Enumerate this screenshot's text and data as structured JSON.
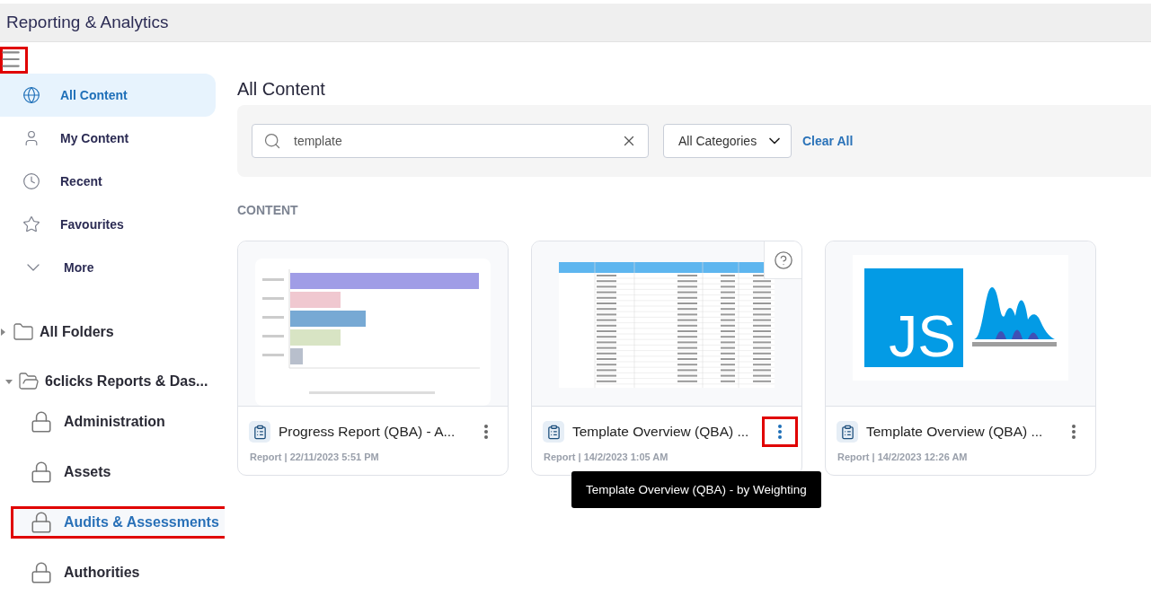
{
  "header": {
    "title": "Reporting & Analytics"
  },
  "menu_button": {
    "highlighted": true
  },
  "nav": [
    {
      "label": "All Content",
      "kind": "globe",
      "selected": true
    },
    {
      "label": "My Content",
      "kind": "user",
      "selected": false
    },
    {
      "label": "Recent",
      "kind": "clock",
      "selected": false
    },
    {
      "label": "Favourites",
      "kind": "star",
      "selected": false
    },
    {
      "label": "More",
      "kind": "chevron",
      "selected": false
    }
  ],
  "folders": [
    {
      "label": "All Folders",
      "expanded": false
    },
    {
      "label": "6clicks Reports & Das...",
      "expanded": true,
      "children": [
        {
          "label": "Administration",
          "selected": false,
          "highlighted": false
        },
        {
          "label": "Assets",
          "selected": false,
          "highlighted": false
        },
        {
          "label": "Audits & Assessments",
          "selected": true,
          "highlighted": true
        },
        {
          "label": "Authorities",
          "selected": false,
          "highlighted": false
        }
      ]
    }
  ],
  "main": {
    "title": "All Content",
    "search": {
      "value": "template"
    },
    "category": {
      "value": "All Categories"
    },
    "clear": "Clear All",
    "section": "CONTENT"
  },
  "cards": [
    {
      "kind": "bar_chart",
      "title": "Progress Report (QBA) - A...",
      "meta": "Report | 22/11/2023 5:51 PM",
      "help": false,
      "menu_highlighted": false
    },
    {
      "kind": "table",
      "title": "Template Overview (QBA) ...",
      "meta": "Report | 14/2/2023 1:05 AM",
      "help": true,
      "menu_highlighted": true,
      "tooltip": "Template Overview (QBA) - by Weighting"
    },
    {
      "kind": "logo",
      "logo_text": "JS",
      "title": "Template Overview (QBA) ...",
      "meta": "Report | 14/2/2023 12:26 AM",
      "help": false,
      "menu_highlighted": false
    }
  ]
}
